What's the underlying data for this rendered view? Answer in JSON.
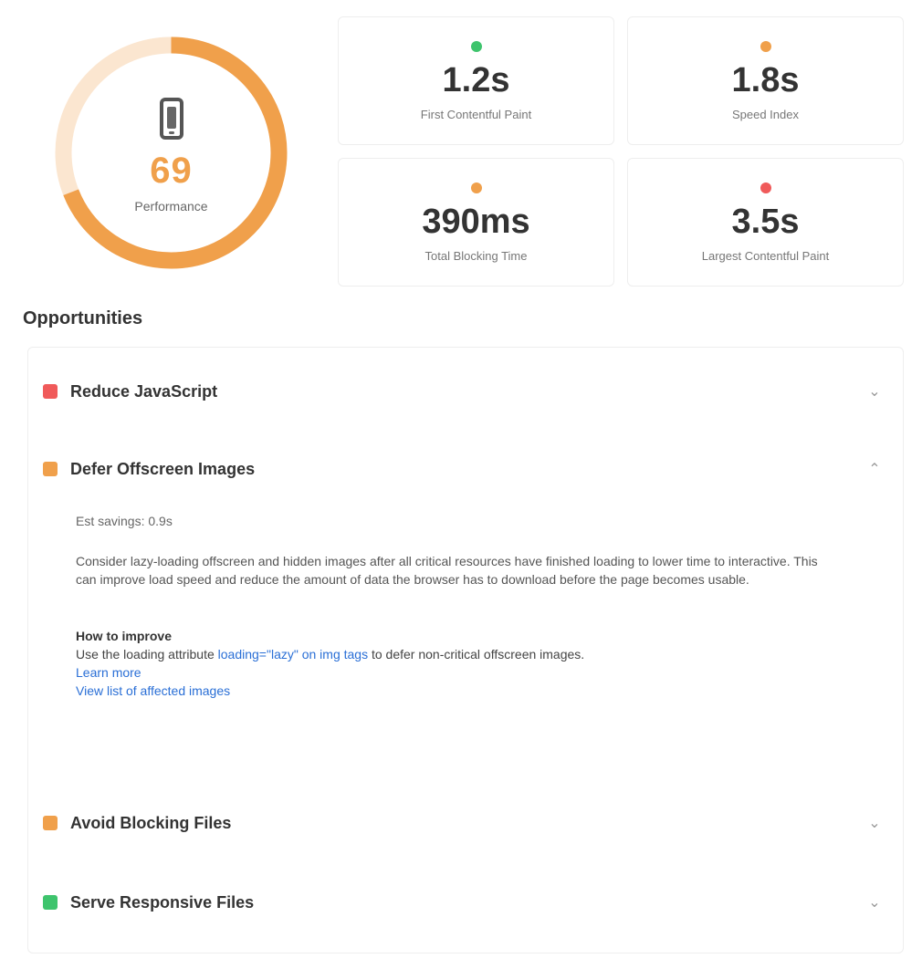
{
  "score": {
    "value": 69,
    "display": "69",
    "label": "Performance",
    "device_icon": "mobile-device-icon",
    "color": "#f0a04b"
  },
  "metrics": [
    {
      "value": "1.2s",
      "label": "First Contentful Paint",
      "status_color": "#3ec46d"
    },
    {
      "value": "1.8s",
      "label": "Speed Index",
      "status_color": "#f0a04b"
    },
    {
      "value": "390ms",
      "label": "Total Blocking Time",
      "status_color": "#f0a04b"
    },
    {
      "value": "3.5s",
      "label": "Largest Contentful Paint",
      "status_color": "#f05a5a"
    }
  ],
  "section_title": "Opportunities",
  "opportunities": [
    {
      "title": "Reduce JavaScript",
      "status_color": "#f05a5a",
      "expanded": false
    },
    {
      "title": "Defer Offscreen Images",
      "status_color": "#f0a04b",
      "expanded": true
    },
    {
      "title": "Avoid Blocking Files",
      "status_color": "#f0a04b",
      "expanded": false
    },
    {
      "title": "Serve Responsive Files",
      "status_color": "#3ec46d",
      "expanded": false
    }
  ],
  "expanded_detail": {
    "meta": "Est savings: 0.9s",
    "description": "Consider lazy-loading offscreen and hidden images after all critical resources have finished loading to lower time to interactive. This can improve load speed and reduce the amount of data the browser has to download before the page becomes usable.",
    "subtitle": "How to improve",
    "text_before_link": "Use the loading attribute",
    "inline_link": "loading=\"lazy\" on img tags",
    "text_after_link": "to defer non-critical offscreen images.",
    "link_learn_more": "Learn more",
    "link_view_images": "View list of affected images"
  }
}
